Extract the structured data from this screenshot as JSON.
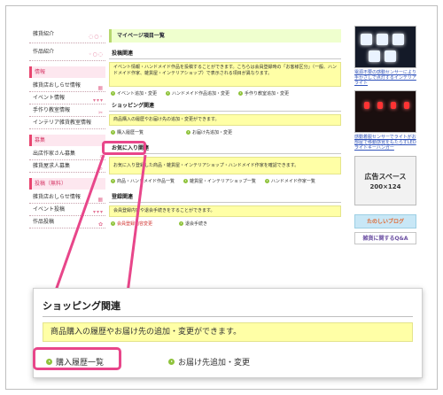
{
  "sidebar": {
    "top_items": [
      "雑貨紹介",
      "作品紹介"
    ],
    "sections": [
      {
        "head": "情報",
        "items": [
          "雑貨店おしらせ情報",
          "イベント情報",
          "手作り教室情報",
          "インテリア雑貨教室情報"
        ]
      },
      {
        "head": "募集",
        "items": [
          "出店作家さん募集",
          "雑貨屋求人募集"
        ]
      },
      {
        "head": "投稿（無料）",
        "items": [
          "雑貨店おしらせ情報",
          "イベント投稿",
          "作品投稿"
        ]
      }
    ]
  },
  "main": {
    "page_title": "マイページ項目一覧",
    "sections": [
      {
        "title": "投稿関連",
        "desc": "イベント情報・ハンドメイド作品を投稿することができます。こちらは会員登録時の「お客様区分」（一般、ハンドメイド作家、雑貨屋・インテリアショップ）で表示される項目が異なります。",
        "links": [
          "イベント追加・変更",
          "ハンドメイド作品追加・変更",
          "手作り教室追加・変更"
        ]
      },
      {
        "title": "ショッピング関連",
        "desc": "商品購入の履歴やお届け先の追加・変更ができます。",
        "links": [
          "購入履歴一覧",
          "お届け先追加・変更"
        ]
      },
      {
        "title": "お気に入り関連",
        "desc": "お気に入り登録した商品・雑貨屋・インテリアショップ・ハンドメイド作家を確認できます。",
        "links": [
          "商品・ハンドメイド作品一覧",
          "雑貨屋・インテリアショップ一覧",
          "ハンドメイド作家一覧"
        ]
      },
      {
        "title": "登録関連",
        "desc": "会員登録内容や退会手続きをすることができます。",
        "links": [
          "会員登録内容変更",
          "退会手続き"
        ]
      }
    ]
  },
  "right": {
    "caption1": "電源不要の感動センサーにより手かざしで点灯するインテリアライト",
    "caption2": "感動着脱センサーでライトがお部屋で移動感覚をもたらすLEDライトキーハンガー",
    "ad_line1": "広告スペース",
    "ad_line2": "200×124",
    "banner1": "たのしいブログ",
    "banner2": "雑貨に関するQ&A"
  },
  "zoom": {
    "title": "ショッピング関連",
    "desc": "商品購入の履歴やお届け先の追加・変更ができます。",
    "link1": "購入履歴一覧",
    "link2": "お届け先追加・変更"
  },
  "colors": {
    "accent_pink": "#e8468a",
    "highlight_yellow": "#ffffa6",
    "title_green": "#efffce",
    "link_dot": "#8fc33c"
  }
}
